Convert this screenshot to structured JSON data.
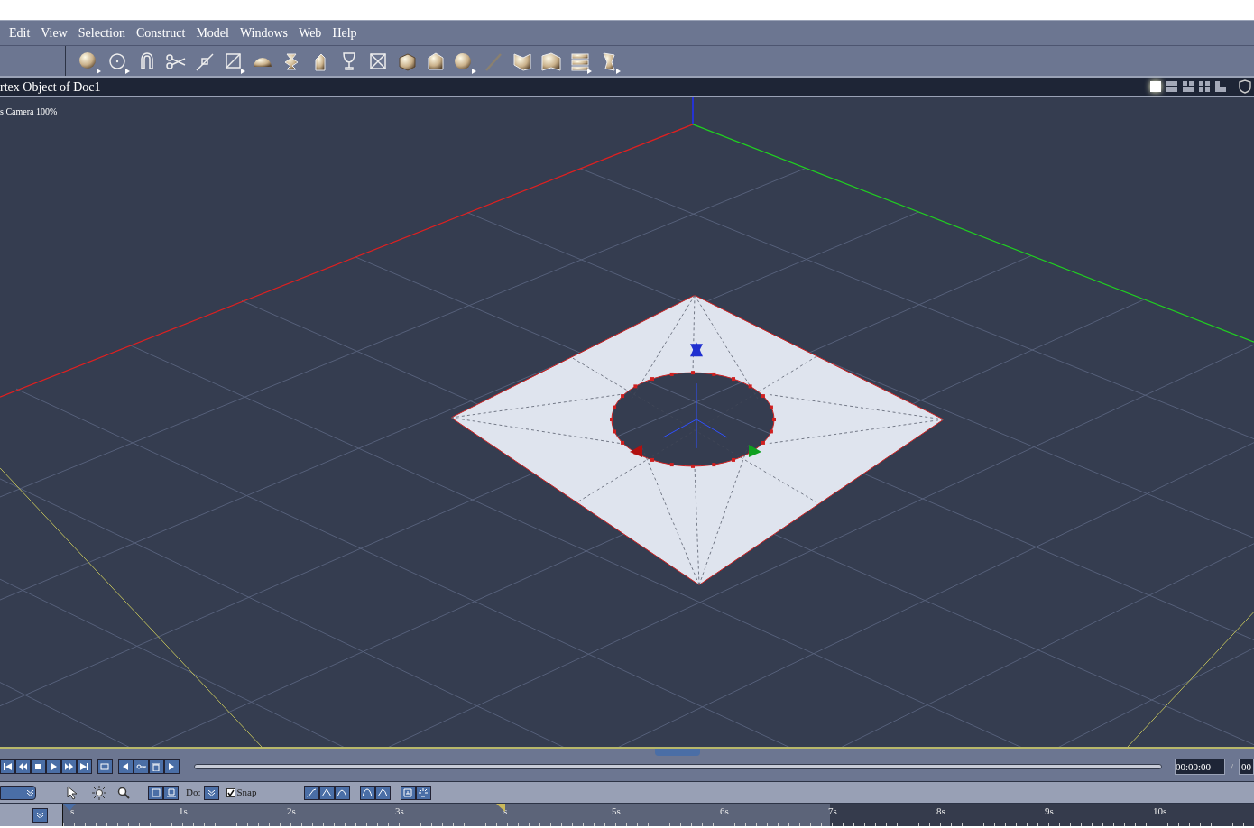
{
  "menu": [
    "Edit",
    "View",
    "Selection",
    "Construct",
    "Model",
    "Windows",
    "Web",
    "Help"
  ],
  "document": {
    "title": "rtex Object of Doc1",
    "camera_label": "s Camera 100%"
  },
  "layout_buttons": [
    {
      "kind": "single",
      "selected": true
    },
    {
      "kind": "rows",
      "selected": false
    },
    {
      "kind": "three",
      "selected": false
    },
    {
      "kind": "quad",
      "selected": false
    },
    {
      "kind": "corner",
      "selected": false
    }
  ],
  "transport": {
    "time": "00:00:00",
    "separator": "/",
    "total": "00"
  },
  "tools": {
    "do_label": "Do:",
    "snap": {
      "label": "Snap",
      "checked": true
    }
  },
  "timeline": {
    "ticks": [
      "s",
      "1s",
      "2s",
      "3s",
      "s",
      "5s",
      "6s",
      "7s",
      "8s",
      "9s",
      "10s"
    ]
  }
}
